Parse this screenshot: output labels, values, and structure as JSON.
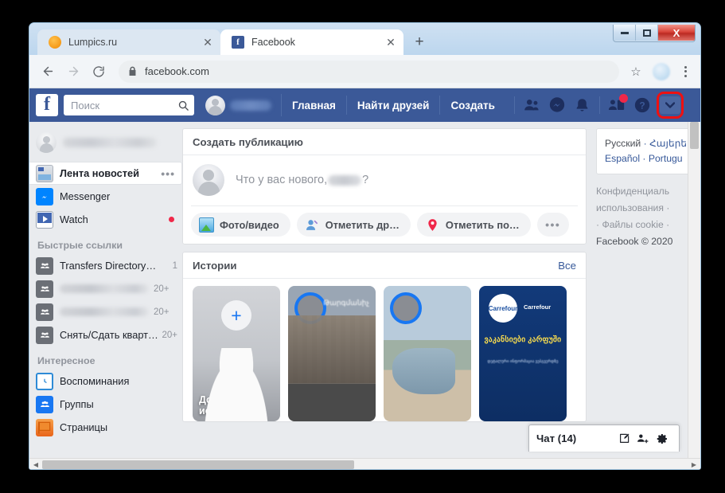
{
  "window": {
    "controls": {
      "minimize": "minimize-button",
      "maximize": "maximize-button",
      "close": "X"
    }
  },
  "browser": {
    "tabs": [
      {
        "title": "Lumpics.ru",
        "favicon": "lumpics-favicon",
        "active": false,
        "close": "✕"
      },
      {
        "title": "Facebook",
        "favicon": "facebook-favicon",
        "active": true,
        "close": "✕"
      }
    ],
    "new_tab_label": "+",
    "toolbar": {
      "back": "←",
      "forward": "→",
      "reload": "⟳",
      "url": "facebook.com",
      "lock": "lock-icon",
      "star": "☆",
      "menu": "chrome-menu-icon"
    }
  },
  "fb_topbar": {
    "logo": "f",
    "search_placeholder": "Поиск",
    "search_icon": "search-icon",
    "nav_links": [
      "Главная",
      "Найти друзей",
      "Создать"
    ],
    "icons": [
      {
        "name": "friend-requests-icon"
      },
      {
        "name": "messenger-icon"
      },
      {
        "name": "notifications-bell-icon"
      },
      {
        "name": "find-friends-icon",
        "badge": true
      },
      {
        "name": "help-icon",
        "glyph": "?"
      },
      {
        "name": "account-dropdown-caret",
        "highlighted": true
      }
    ]
  },
  "sidebar": {
    "profile_name_blurred": true,
    "items": [
      {
        "label": "Лента новостей",
        "icon": "news-feed-icon",
        "selected": true,
        "trailing": "•••"
      },
      {
        "label": "Messenger",
        "icon": "messenger-icon",
        "selected": false
      },
      {
        "label": "Watch",
        "icon": "watch-icon",
        "selected": false,
        "dot": true
      }
    ],
    "quick_links_header": "Быстрые ссылки",
    "quick_links": [
      {
        "label": "Transfers Directory…",
        "badge": "1",
        "blurred": false
      },
      {
        "label": "",
        "badge": "20+",
        "blurred": true
      },
      {
        "label": "",
        "badge": "20+",
        "blurred": true
      },
      {
        "label": "Снять/Сдать кварт…",
        "badge": "20+",
        "blurred": false
      }
    ],
    "explore_header": "Интересное",
    "explore": [
      {
        "label": "Воспоминания",
        "icon": "memories-icon"
      },
      {
        "label": "Группы",
        "icon": "groups-icon"
      },
      {
        "label": "Страницы",
        "icon": "pages-icon"
      }
    ]
  },
  "composer": {
    "title": "Создать публикацию",
    "prompt_prefix": "Что у вас нового,",
    "prompt_suffix": "?",
    "actions": [
      {
        "label": "Фото/видео",
        "icon": "photo-video-icon"
      },
      {
        "label": "Отметить др…",
        "icon": "tag-friends-icon"
      },
      {
        "label": "Отметить по…",
        "icon": "location-pin-icon"
      }
    ],
    "more_label": "•••"
  },
  "stories": {
    "title": "Истории",
    "see_all": "Все",
    "cards": [
      {
        "type": "add",
        "plus": "+",
        "caption": "Дополнить историю"
      },
      {
        "type": "photo",
        "caption": "",
        "overlay_text": "Թարգմանիչ"
      },
      {
        "type": "photo",
        "caption": ""
      },
      {
        "type": "promo",
        "logo_text": "Carrefour",
        "brand": "Carrefour",
        "title": "ვაკანსიები კარფუში",
        "body": "დეტალური ინფორმაცია ვებგვერდზე"
      }
    ]
  },
  "right_rail": {
    "languages": [
      "Русский",
      "Հայերե",
      "Español",
      "Portugu"
    ],
    "separator": " · ",
    "footer_lines": [
      "Конфиденциаль",
      "использования ·",
      "· Файлы cookie ·",
      "Facebook © 2020"
    ]
  },
  "chat_bar": {
    "label": "Чат (14)",
    "icons": [
      {
        "name": "new-message-icon"
      },
      {
        "name": "add-people-icon"
      },
      {
        "name": "chat-settings-gear-icon"
      }
    ]
  },
  "scrollbars": {
    "vertical_down": "▼",
    "horizontal_left": "◀",
    "horizontal_right": "▶"
  },
  "colors": {
    "fb_blue": "#3b5998",
    "accent_blue": "#1877f2",
    "badge_red": "#f02849",
    "highlight_red": "#ee1111",
    "page_bg": "#e9ebee"
  }
}
